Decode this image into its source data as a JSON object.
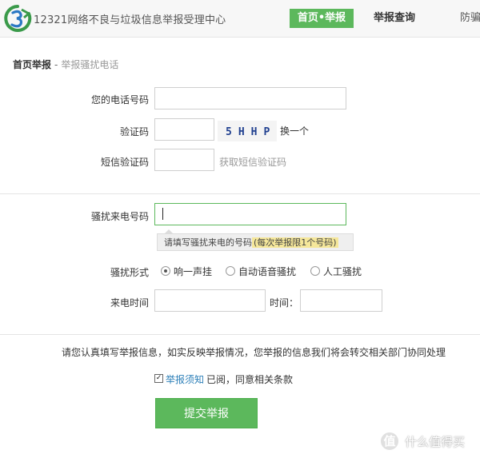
{
  "header": {
    "site_title": "12321网络不良与垃圾信息举报受理中心",
    "nav": [
      {
        "label": "首页•举报",
        "active": true
      },
      {
        "label": "举报查询",
        "active": false
      },
      {
        "label": "防骗",
        "active": false
      }
    ]
  },
  "breadcrumb": {
    "home": "首页举报",
    "separator": "-",
    "current": "举报骚扰电话"
  },
  "form": {
    "phone_label": "您的电话号码",
    "phone_value": "",
    "captcha_label": "验证码",
    "captcha_value": "",
    "captcha_text": "5HHP",
    "refresh_captcha": "换一个",
    "sms_label": "短信验证码",
    "sms_value": "",
    "get_sms_code": "获取短信验证码",
    "harass_label": "骚扰来电号码",
    "harass_value": "",
    "tooltip_text": "请填写骚扰来电的号码",
    "tooltip_highlight": "(每次举报限1个号码)",
    "type_label": "骚扰形式",
    "type_options": [
      {
        "label": "响一声挂",
        "checked": true
      },
      {
        "label": "自动语音骚扰",
        "checked": false
      },
      {
        "label": "人工骚扰",
        "checked": false
      }
    ],
    "date_label": "来电时间",
    "date_value": "",
    "time_label": "时间：",
    "time_value": ""
  },
  "footer": {
    "notice": "请您认真填写举报信息，如实反映举报情况，您举报的信息我们将会转交相关部门协同处理",
    "agree_checked": true,
    "agree_link": "举报须知",
    "agree_text": "已阅，同意相关条款",
    "submit_label": "提交举报"
  },
  "watermark": {
    "symbol": "值",
    "text": "什么值得买"
  },
  "colors": {
    "accent": "#5cb85c",
    "link": "#2c7fb8",
    "tooltip_highlight": "#f5e79a"
  }
}
